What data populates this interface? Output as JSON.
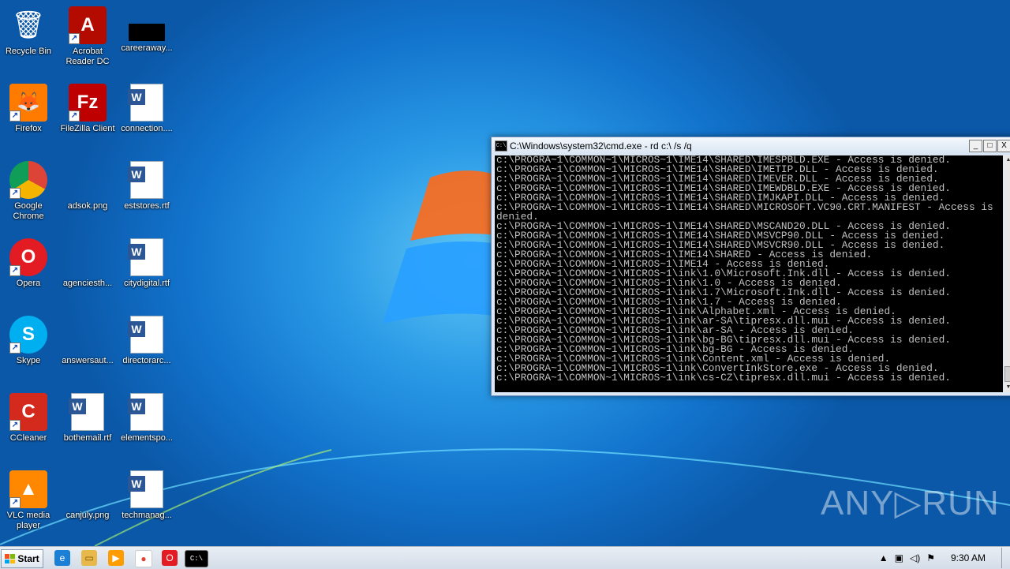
{
  "desktop_icons": [
    {
      "label": "Recycle Bin",
      "glyph": "🗑",
      "bg": "transparent",
      "x": 0
    },
    {
      "label": "Acrobat\nReader DC",
      "glyph": "A",
      "bg": "#b30b00"
    },
    {
      "label": "careeraway...",
      "glyph": "",
      "bg": "#000"
    },
    {
      "label": "Firefox",
      "glyph": "🦊",
      "bg": "#ff7b00"
    },
    {
      "label": "FileZilla Client",
      "glyph": "Fz",
      "bg": "#bf0000"
    },
    {
      "label": "connection....",
      "glyph": "W",
      "bg": "#fff"
    },
    {
      "label": "Google\nChrome",
      "glyph": "●",
      "bg": "#fff"
    },
    {
      "label": "adsok.png",
      "glyph": "",
      "bg": "transparent"
    },
    {
      "label": "eststores.rtf",
      "glyph": "W",
      "bg": "#fff"
    },
    {
      "label": "Opera",
      "glyph": "O",
      "bg": "#e31b23"
    },
    {
      "label": "agenciesth...",
      "glyph": "",
      "bg": "transparent"
    },
    {
      "label": "citydigital.rtf",
      "glyph": "W",
      "bg": "#fff"
    },
    {
      "label": "Skype",
      "glyph": "S",
      "bg": "#00aff0"
    },
    {
      "label": "answersaut...",
      "glyph": "",
      "bg": "transparent"
    },
    {
      "label": "directorarc...",
      "glyph": "W",
      "bg": "#fff"
    },
    {
      "label": "CCleaner",
      "glyph": "C",
      "bg": "#d42a1e"
    },
    {
      "label": "bothemail.rtf",
      "glyph": "W",
      "bg": "#fff"
    },
    {
      "label": "elementspo...",
      "glyph": "W",
      "bg": "#fff"
    },
    {
      "label": "VLC media\nplayer",
      "glyph": "▲",
      "bg": "#ff8800"
    },
    {
      "label": "canjuly.png",
      "glyph": "",
      "bg": "transparent"
    },
    {
      "label": "techmanag...",
      "glyph": "W",
      "bg": "#fff"
    }
  ],
  "cmd_window": {
    "title": "C:\\Windows\\system32\\cmd.exe - rd  c:\\ /s /q",
    "minimize": "_",
    "maximize": "□",
    "close": "X",
    "output": [
      "c:\\PROGRA~1\\COMMON~1\\MICROS~1\\IME14\\SHARED\\IMESPBLD.EXE - Access is denied.",
      "c:\\PROGRA~1\\COMMON~1\\MICROS~1\\IME14\\SHARED\\IMETIP.DLL - Access is denied.",
      "c:\\PROGRA~1\\COMMON~1\\MICROS~1\\IME14\\SHARED\\IMEVER.DLL - Access is denied.",
      "c:\\PROGRA~1\\COMMON~1\\MICROS~1\\IME14\\SHARED\\IMEWDBLD.EXE - Access is denied.",
      "c:\\PROGRA~1\\COMMON~1\\MICROS~1\\IME14\\SHARED\\IMJKAPI.DLL - Access is denied.",
      "c:\\PROGRA~1\\COMMON~1\\MICROS~1\\IME14\\SHARED\\MICROSOFT.VC90.CRT.MANIFEST - Access is denied.",
      "c:\\PROGRA~1\\COMMON~1\\MICROS~1\\IME14\\SHARED\\MSCAND20.DLL - Access is denied.",
      "c:\\PROGRA~1\\COMMON~1\\MICROS~1\\IME14\\SHARED\\MSVCP90.DLL - Access is denied.",
      "c:\\PROGRA~1\\COMMON~1\\MICROS~1\\IME14\\SHARED\\MSVCR90.DLL - Access is denied.",
      "c:\\PROGRA~1\\COMMON~1\\MICROS~1\\IME14\\SHARED - Access is denied.",
      "c:\\PROGRA~1\\COMMON~1\\MICROS~1\\IME14 - Access is denied.",
      "c:\\PROGRA~1\\COMMON~1\\MICROS~1\\ink\\1.0\\Microsoft.Ink.dll - Access is denied.",
      "c:\\PROGRA~1\\COMMON~1\\MICROS~1\\ink\\1.0 - Access is denied.",
      "c:\\PROGRA~1\\COMMON~1\\MICROS~1\\ink\\1.7\\Microsoft.Ink.dll - Access is denied.",
      "c:\\PROGRA~1\\COMMON~1\\MICROS~1\\ink\\1.7 - Access is denied.",
      "c:\\PROGRA~1\\COMMON~1\\MICROS~1\\ink\\Alphabet.xml - Access is denied.",
      "c:\\PROGRA~1\\COMMON~1\\MICROS~1\\ink\\ar-SA\\tipresx.dll.mui - Access is denied.",
      "c:\\PROGRA~1\\COMMON~1\\MICROS~1\\ink\\ar-SA - Access is denied.",
      "c:\\PROGRA~1\\COMMON~1\\MICROS~1\\ink\\bg-BG\\tipresx.dll.mui - Access is denied.",
      "c:\\PROGRA~1\\COMMON~1\\MICROS~1\\ink\\bg-BG - Access is denied.",
      "c:\\PROGRA~1\\COMMON~1\\MICROS~1\\ink\\Content.xml - Access is denied.",
      "c:\\PROGRA~1\\COMMON~1\\MICROS~1\\ink\\ConvertInkStore.exe - Access is denied.",
      "c:\\PROGRA~1\\COMMON~1\\MICROS~1\\ink\\cs-CZ\\tipresx.dll.mui - Access is denied."
    ]
  },
  "taskbar": {
    "start_label": "Start",
    "clock": "9:30 AM",
    "pinned": [
      "ie-icon",
      "explorer-icon",
      "media-player-icon",
      "chrome-icon",
      "opera-icon",
      "cmd-icon"
    ]
  },
  "watermark": "ANY▷RUN"
}
